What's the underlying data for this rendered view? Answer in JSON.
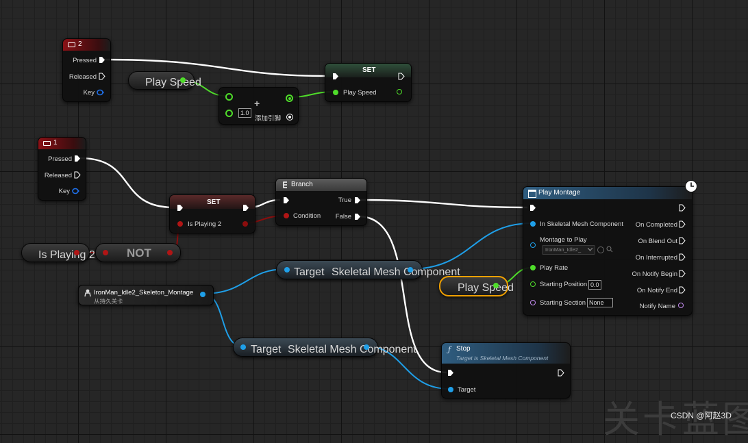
{
  "nodes": {
    "key2": {
      "title": "2",
      "pins": [
        "Pressed",
        "Released",
        "Key"
      ]
    },
    "play_speed_get_1": {
      "label": "Play Speed"
    },
    "add": {
      "symbol": "+",
      "value": "1.0",
      "add_pin": "添加引脚"
    },
    "set_top": {
      "title": "SET",
      "pin": "Play Speed"
    },
    "key1": {
      "title": "1",
      "pins": [
        "Pressed",
        "Released",
        "Key"
      ]
    },
    "set_mid": {
      "title": "SET",
      "pin": "Is Playing 2"
    },
    "branch": {
      "title": "Branch",
      "condition": "Condition",
      "true": "True",
      "false": "False"
    },
    "is_playing_get": {
      "label": "Is Playing 2"
    },
    "not": {
      "label": "NOT"
    },
    "montage_ref": {
      "title": "IronMan_Idle2_Skeleton_Montage",
      "subtitle": "从持久关卡"
    },
    "target_smc_1": {
      "target": "Target",
      "output": "Skeletal Mesh Component"
    },
    "target_smc_2": {
      "target": "Target",
      "output": "Skeletal Mesh Component"
    },
    "play_montage": {
      "title": "Play Montage",
      "inputs": [
        "In Skeletal Mesh Component",
        "Montage to Play",
        "Play Rate",
        "Starting Position",
        "Starting Section"
      ],
      "outputs": [
        "On Completed",
        "On Blend Out",
        "On Interrupted",
        "On Notify Begin",
        "On Notify End",
        "Notify Name"
      ],
      "montage_value": "IronMan_Idle2_",
      "starting_position": "0.0",
      "starting_section": "None"
    },
    "play_speed_get_2": {
      "label": "Play Speed"
    },
    "stop": {
      "title": "Stop",
      "subtitle": "Target is Skeletal Mesh Component",
      "target": "Target"
    }
  },
  "watermark": {
    "big": "关卡蓝图",
    "credit": "CSDN @阿赵3D"
  },
  "colors": {
    "exec": "#ffffff",
    "float": "#4fdc2a",
    "bool": "#8c0d0d",
    "object": "#1f9fe8",
    "name": "#c48cf0",
    "key_struct": "#1f6fe8",
    "selected_outline": "#f0a000"
  },
  "icons": [
    "keyboard-icon",
    "clock-icon",
    "branch-icon",
    "function-icon",
    "montage-icon",
    "person-icon",
    "dropdown-icon",
    "search-icon"
  ]
}
